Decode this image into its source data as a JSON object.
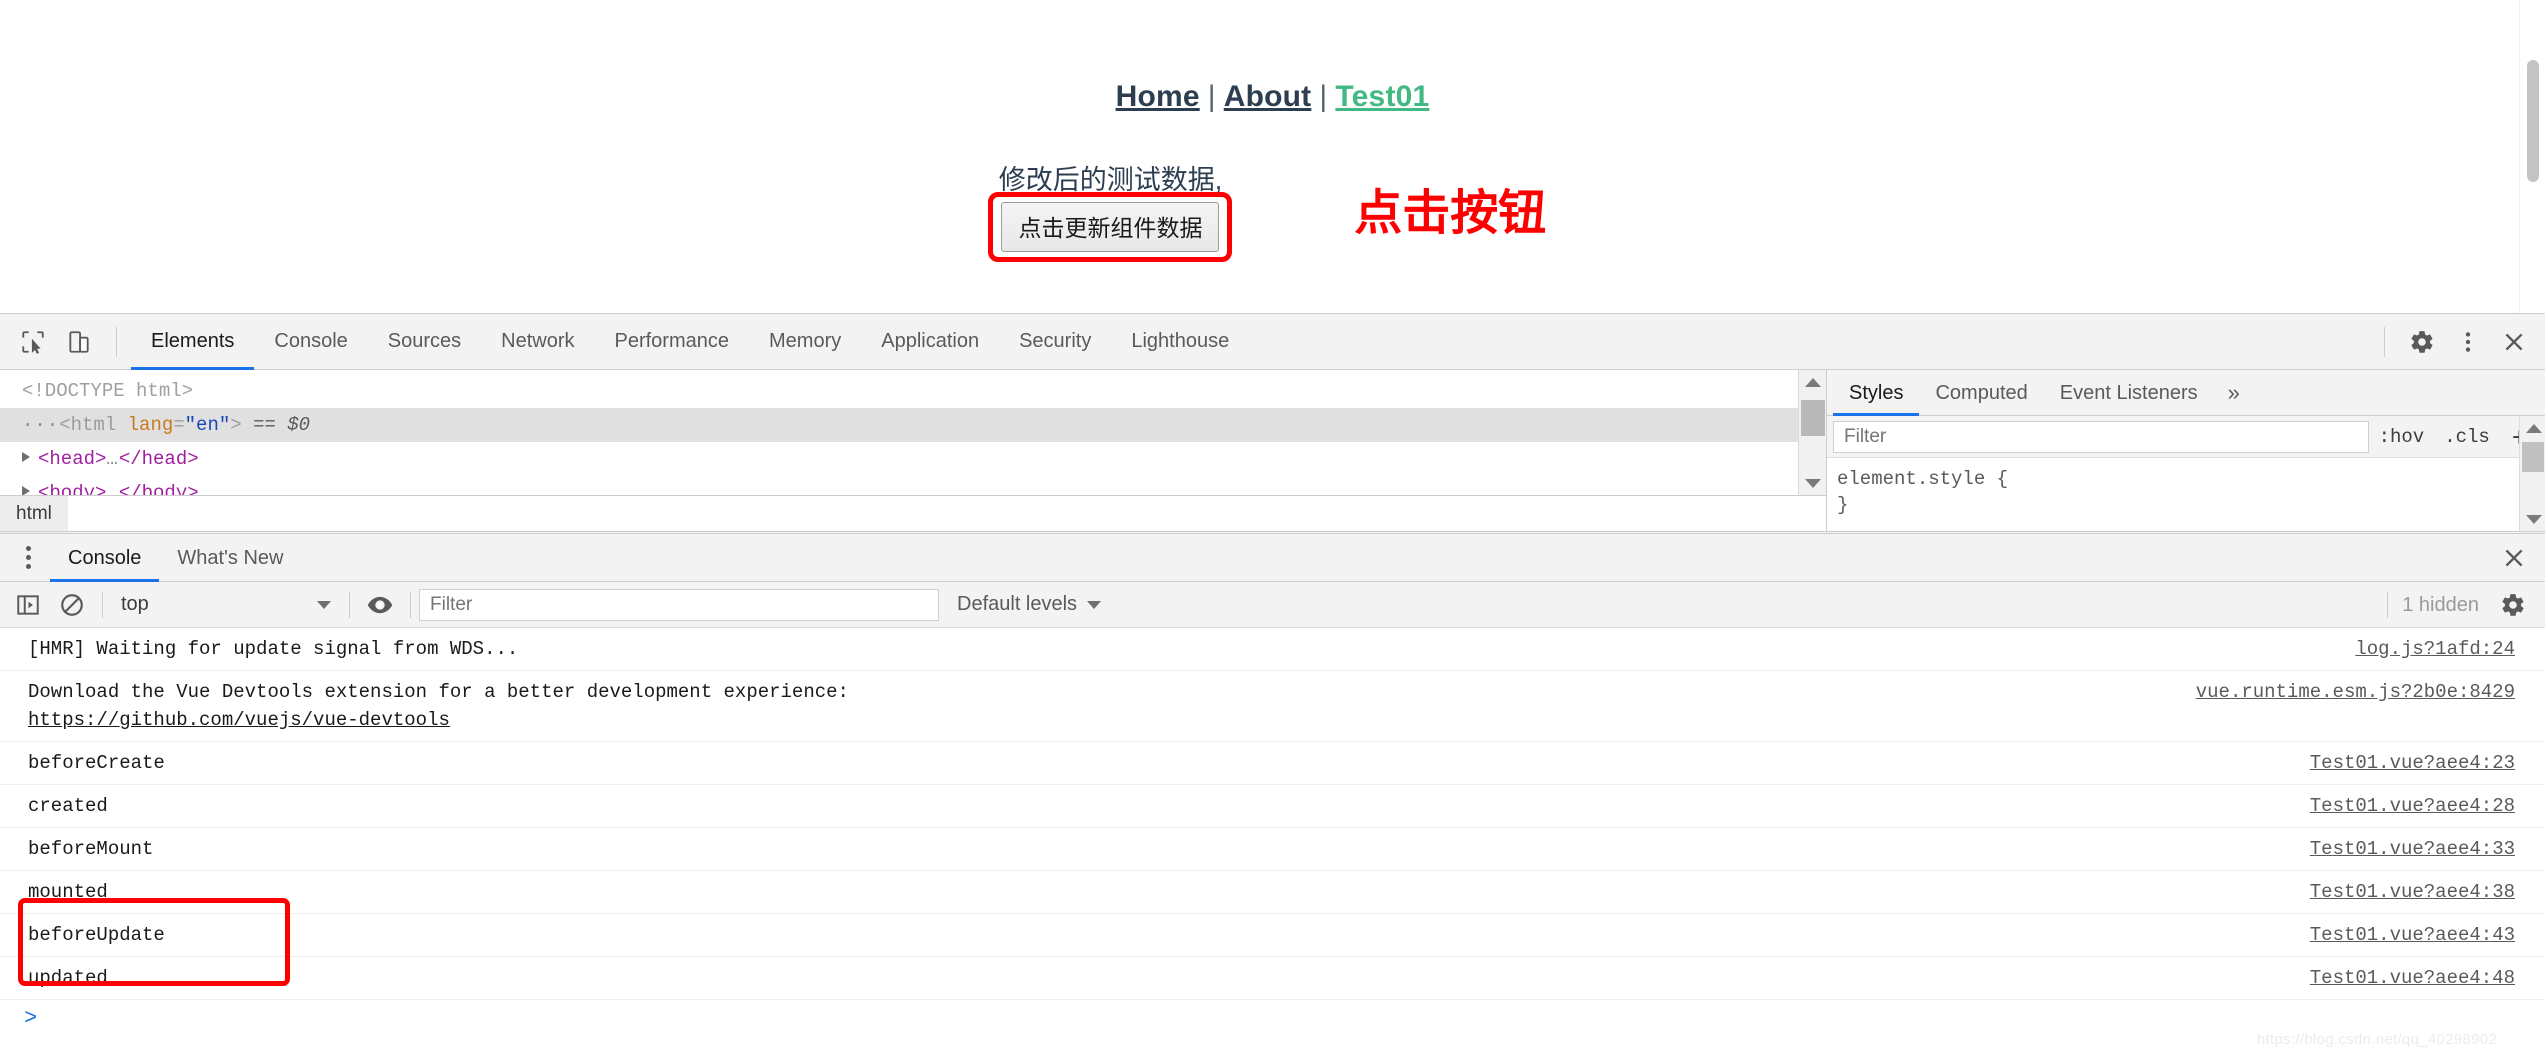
{
  "page": {
    "nav": {
      "home_label": "Home",
      "about_label": "About",
      "test_label": "Test01",
      "separator": "|",
      "active_color": "#42b983",
      "link_color": "#2c3e50"
    },
    "test_message": "修改后的测试数据,",
    "update_button_label": "点击更新组件数据",
    "annotation_text": "点击按钮",
    "annotation_color": "#ff0000"
  },
  "devtools": {
    "toolbar": {
      "inspect_icon": "inspect-element-icon",
      "device_icon": "device-toolbar-icon",
      "settings_icon": "gear-icon",
      "more_icon": "kebab-menu-icon",
      "close_icon": "close-icon"
    },
    "tabs": [
      {
        "label": "Elements",
        "active": true
      },
      {
        "label": "Console",
        "active": false
      },
      {
        "label": "Sources",
        "active": false
      },
      {
        "label": "Network",
        "active": false
      },
      {
        "label": "Performance",
        "active": false
      },
      {
        "label": "Memory",
        "active": false
      },
      {
        "label": "Application",
        "active": false
      },
      {
        "label": "Security",
        "active": false
      },
      {
        "label": "Lighthouse",
        "active": false
      }
    ],
    "elements": {
      "dom": [
        {
          "kind": "doctype",
          "text": "<!DOCTYPE html>"
        },
        {
          "kind": "html",
          "prefix": "···",
          "open": "<html",
          "attr_name": "lang",
          "attr_value": "\"en\"",
          "close": ">",
          "suffix": "== $0",
          "selected": true
        },
        {
          "kind": "node",
          "tag": "head",
          "text_open": "<head>",
          "ellipsis": "…",
          "text_close": "</head>"
        },
        {
          "kind": "node",
          "tag": "body",
          "text_open": "<body>",
          "ellipsis": "…",
          "text_close": "</body>"
        }
      ],
      "breadcrumb": [
        "html"
      ]
    },
    "styles": {
      "tabs": [
        {
          "label": "Styles",
          "active": true
        },
        {
          "label": "Computed",
          "active": false
        },
        {
          "label": "Event Listeners",
          "active": false
        }
      ],
      "more_label": "»",
      "filter_placeholder": "Filter",
      "filter_value": "",
      "hov_label": ":hov",
      "cls_label": ".cls",
      "plus_label": "+",
      "rules": [
        "element.style {",
        "}"
      ]
    },
    "drawer": {
      "tabs": [
        {
          "label": "Console",
          "active": true
        },
        {
          "label": "What's New",
          "active": false
        }
      ],
      "close_icon": "close-icon"
    },
    "console": {
      "sidebar_icon": "console-sidebar-icon",
      "clear_icon": "clear-console-icon",
      "context_value": "top",
      "eye_icon": "live-expression-icon",
      "filter_placeholder": "Filter",
      "filter_value": "",
      "levels_label": "Default levels",
      "hidden_label": "1 hidden",
      "settings_icon": "gear-icon",
      "prompt": ">",
      "messages": [
        {
          "text": "[HMR] Waiting for update signal from WDS...",
          "source": "log.js?1afd:24",
          "link": null,
          "highlighted": false
        },
        {
          "text": "Download the Vue Devtools extension for a better development experience:",
          "link": "https://github.com/vuejs/vue-devtools",
          "source": "vue.runtime.esm.js?2b0e:8429",
          "highlighted": false
        },
        {
          "text": "beforeCreate",
          "source": "Test01.vue?aee4:23",
          "link": null,
          "highlighted": false
        },
        {
          "text": "created",
          "source": "Test01.vue?aee4:28",
          "link": null,
          "highlighted": false
        },
        {
          "text": "beforeMount",
          "source": "Test01.vue?aee4:33",
          "link": null,
          "highlighted": false
        },
        {
          "text": "mounted",
          "source": "Test01.vue?aee4:38",
          "link": null,
          "highlighted": false
        },
        {
          "text": "beforeUpdate",
          "source": "Test01.vue?aee4:43",
          "link": null,
          "highlighted": true
        },
        {
          "text": "updated",
          "source": "Test01.vue?aee4:48",
          "link": null,
          "highlighted": true
        }
      ]
    }
  },
  "watermark": "https://blog.csdn.net/qq_40298902"
}
